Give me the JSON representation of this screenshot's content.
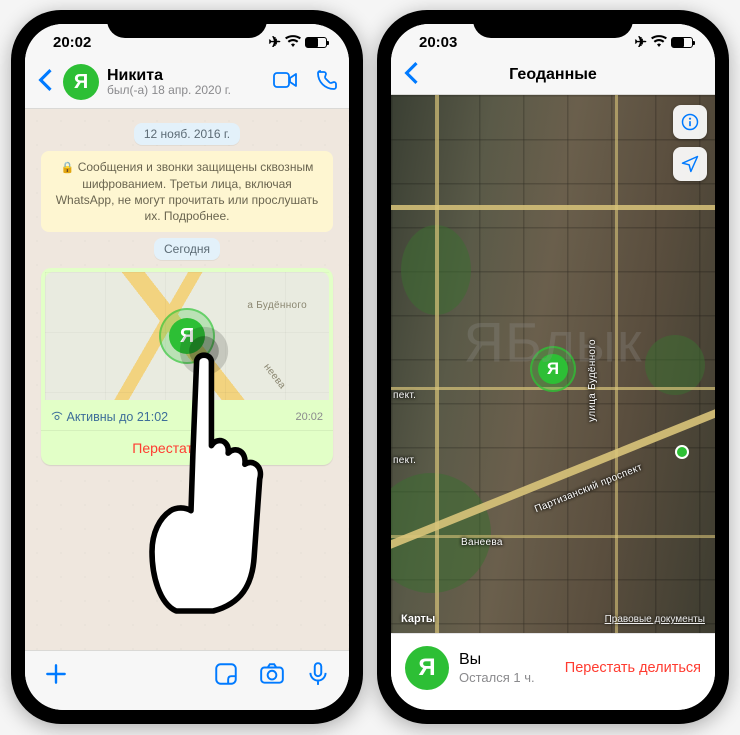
{
  "left": {
    "status_time": "20:02",
    "contact": {
      "name": "Никита",
      "last_seen": "был(-а) 18 апр. 2020 г.",
      "avatar_letter": "Я"
    },
    "dates": {
      "old": "12 нояб. 2016 г.",
      "today": "Сегодня"
    },
    "encryption_notice": "Сообщения и звонки защищены сквозным шифрованием. Третьи лица, включая WhatsApp, не могут прочитать или прослушать их. Подробнее.",
    "live_location": {
      "active_until": "Активны до 21:02",
      "timestamp": "20:02",
      "stop_sharing": "Перестать дел…",
      "map_pin_letter": "Я",
      "street1": "а Будённого",
      "street2": "неева"
    }
  },
  "right": {
    "status_time": "20:03",
    "title": "Геоданные",
    "map": {
      "attribution": "Карты",
      "legal": "Правовые документы",
      "pin_letter": "Я",
      "roads": {
        "budennogo": "улица Будённого",
        "partizansky": "Партизанский проспект",
        "vaneeva": "Ванеева",
        "pekt1": "пект.",
        "pekt2": "пект."
      }
    },
    "footer": {
      "avatar_letter": "Я",
      "you": "Вы",
      "remaining": "Остался 1 ч.",
      "stop_sharing": "Перестать делиться"
    }
  },
  "watermark": "ЯБлык"
}
